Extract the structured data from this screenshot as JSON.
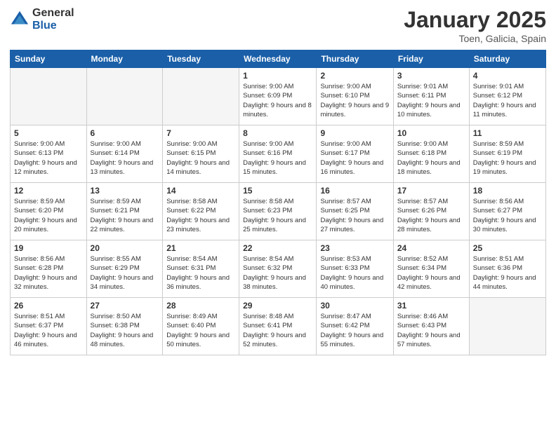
{
  "logo": {
    "general": "General",
    "blue": "Blue"
  },
  "title": "January 2025",
  "subtitle": "Toen, Galicia, Spain",
  "days_header": [
    "Sunday",
    "Monday",
    "Tuesday",
    "Wednesday",
    "Thursday",
    "Friday",
    "Saturday"
  ],
  "weeks": [
    [
      {
        "day": "",
        "info": ""
      },
      {
        "day": "",
        "info": ""
      },
      {
        "day": "",
        "info": ""
      },
      {
        "day": "1",
        "info": "Sunrise: 9:00 AM\nSunset: 6:09 PM\nDaylight: 9 hours and 8 minutes."
      },
      {
        "day": "2",
        "info": "Sunrise: 9:00 AM\nSunset: 6:10 PM\nDaylight: 9 hours and 9 minutes."
      },
      {
        "day": "3",
        "info": "Sunrise: 9:01 AM\nSunset: 6:11 PM\nDaylight: 9 hours and 10 minutes."
      },
      {
        "day": "4",
        "info": "Sunrise: 9:01 AM\nSunset: 6:12 PM\nDaylight: 9 hours and 11 minutes."
      }
    ],
    [
      {
        "day": "5",
        "info": "Sunrise: 9:00 AM\nSunset: 6:13 PM\nDaylight: 9 hours and 12 minutes."
      },
      {
        "day": "6",
        "info": "Sunrise: 9:00 AM\nSunset: 6:14 PM\nDaylight: 9 hours and 13 minutes."
      },
      {
        "day": "7",
        "info": "Sunrise: 9:00 AM\nSunset: 6:15 PM\nDaylight: 9 hours and 14 minutes."
      },
      {
        "day": "8",
        "info": "Sunrise: 9:00 AM\nSunset: 6:16 PM\nDaylight: 9 hours and 15 minutes."
      },
      {
        "day": "9",
        "info": "Sunrise: 9:00 AM\nSunset: 6:17 PM\nDaylight: 9 hours and 16 minutes."
      },
      {
        "day": "10",
        "info": "Sunrise: 9:00 AM\nSunset: 6:18 PM\nDaylight: 9 hours and 18 minutes."
      },
      {
        "day": "11",
        "info": "Sunrise: 8:59 AM\nSunset: 6:19 PM\nDaylight: 9 hours and 19 minutes."
      }
    ],
    [
      {
        "day": "12",
        "info": "Sunrise: 8:59 AM\nSunset: 6:20 PM\nDaylight: 9 hours and 20 minutes."
      },
      {
        "day": "13",
        "info": "Sunrise: 8:59 AM\nSunset: 6:21 PM\nDaylight: 9 hours and 22 minutes."
      },
      {
        "day": "14",
        "info": "Sunrise: 8:58 AM\nSunset: 6:22 PM\nDaylight: 9 hours and 23 minutes."
      },
      {
        "day": "15",
        "info": "Sunrise: 8:58 AM\nSunset: 6:23 PM\nDaylight: 9 hours and 25 minutes."
      },
      {
        "day": "16",
        "info": "Sunrise: 8:57 AM\nSunset: 6:25 PM\nDaylight: 9 hours and 27 minutes."
      },
      {
        "day": "17",
        "info": "Sunrise: 8:57 AM\nSunset: 6:26 PM\nDaylight: 9 hours and 28 minutes."
      },
      {
        "day": "18",
        "info": "Sunrise: 8:56 AM\nSunset: 6:27 PM\nDaylight: 9 hours and 30 minutes."
      }
    ],
    [
      {
        "day": "19",
        "info": "Sunrise: 8:56 AM\nSunset: 6:28 PM\nDaylight: 9 hours and 32 minutes."
      },
      {
        "day": "20",
        "info": "Sunrise: 8:55 AM\nSunset: 6:29 PM\nDaylight: 9 hours and 34 minutes."
      },
      {
        "day": "21",
        "info": "Sunrise: 8:54 AM\nSunset: 6:31 PM\nDaylight: 9 hours and 36 minutes."
      },
      {
        "day": "22",
        "info": "Sunrise: 8:54 AM\nSunset: 6:32 PM\nDaylight: 9 hours and 38 minutes."
      },
      {
        "day": "23",
        "info": "Sunrise: 8:53 AM\nSunset: 6:33 PM\nDaylight: 9 hours and 40 minutes."
      },
      {
        "day": "24",
        "info": "Sunrise: 8:52 AM\nSunset: 6:34 PM\nDaylight: 9 hours and 42 minutes."
      },
      {
        "day": "25",
        "info": "Sunrise: 8:51 AM\nSunset: 6:36 PM\nDaylight: 9 hours and 44 minutes."
      }
    ],
    [
      {
        "day": "26",
        "info": "Sunrise: 8:51 AM\nSunset: 6:37 PM\nDaylight: 9 hours and 46 minutes."
      },
      {
        "day": "27",
        "info": "Sunrise: 8:50 AM\nSunset: 6:38 PM\nDaylight: 9 hours and 48 minutes."
      },
      {
        "day": "28",
        "info": "Sunrise: 8:49 AM\nSunset: 6:40 PM\nDaylight: 9 hours and 50 minutes."
      },
      {
        "day": "29",
        "info": "Sunrise: 8:48 AM\nSunset: 6:41 PM\nDaylight: 9 hours and 52 minutes."
      },
      {
        "day": "30",
        "info": "Sunrise: 8:47 AM\nSunset: 6:42 PM\nDaylight: 9 hours and 55 minutes."
      },
      {
        "day": "31",
        "info": "Sunrise: 8:46 AM\nSunset: 6:43 PM\nDaylight: 9 hours and 57 minutes."
      },
      {
        "day": "",
        "info": ""
      }
    ]
  ]
}
